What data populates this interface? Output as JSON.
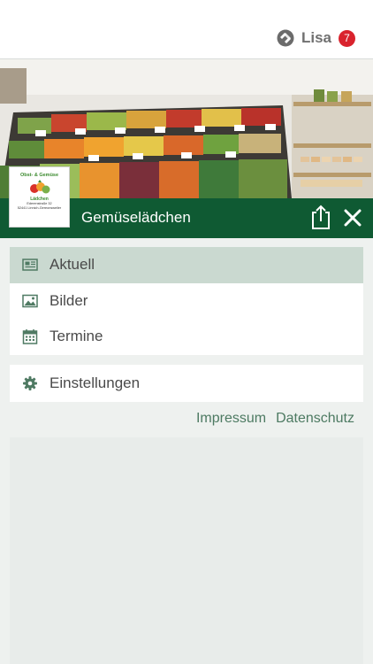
{
  "user": {
    "name": "Lisa",
    "notification_count": "7",
    "icon": "user-logo-icon"
  },
  "shop": {
    "title": "Gemüselädchen",
    "logo": {
      "line1": "Obst- & Gemüse",
      "line2": "Lädchen",
      "line3": "Ederenstraße 32",
      "line4": "52441 Linnich-Gereonsweiler"
    }
  },
  "header_actions": {
    "share_icon": "share-icon",
    "close_icon": "close-icon"
  },
  "menu": {
    "items": [
      {
        "label": "Aktuell",
        "icon": "newspaper-icon",
        "active": true
      },
      {
        "label": "Bilder",
        "icon": "image-icon",
        "active": false
      },
      {
        "label": "Termine",
        "icon": "calendar-icon",
        "active": false
      }
    ],
    "settings": {
      "label": "Einstellungen",
      "icon": "gear-icon"
    }
  },
  "links": {
    "impressum": "Impressum",
    "datenschutz": "Datenschutz"
  },
  "colors": {
    "header_green": "#0f5a33",
    "active_bg": "#cad9d0",
    "badge_red": "#d9232d",
    "link_green": "#4d7a62"
  }
}
